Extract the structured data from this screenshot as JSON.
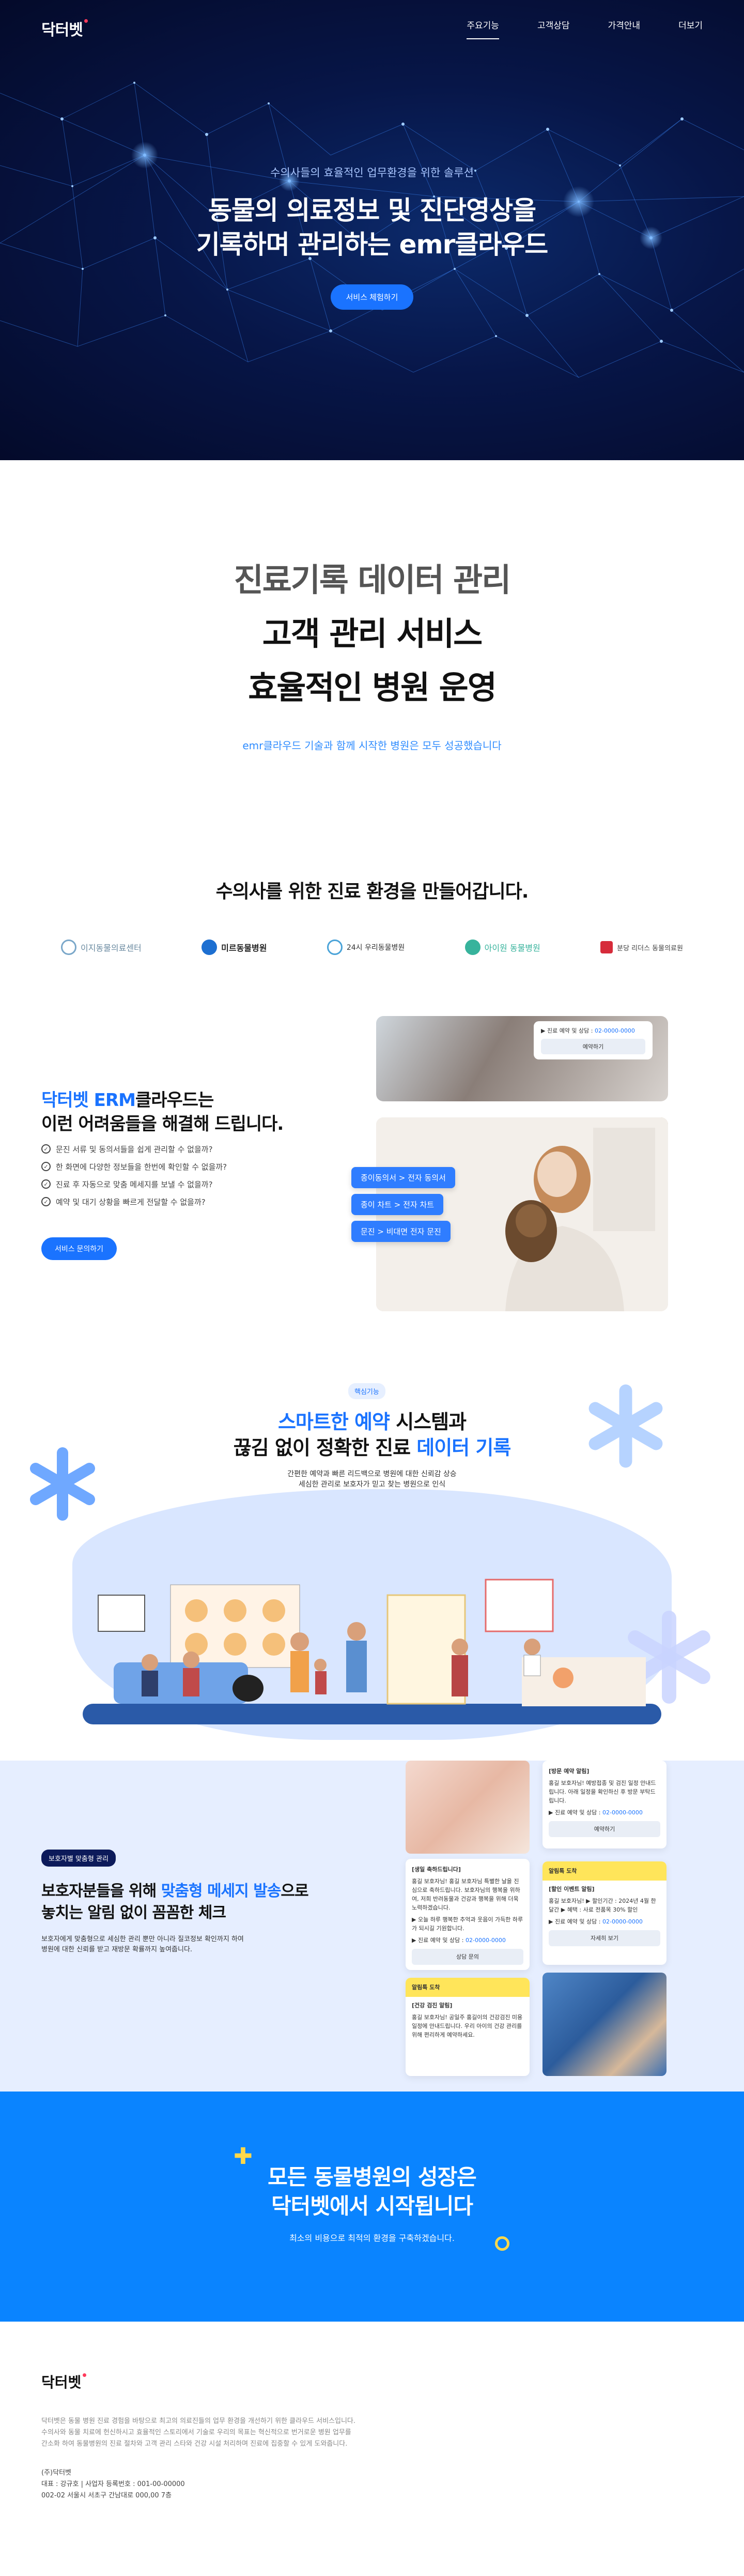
{
  "header": {
    "logo": "닥터벳",
    "nav": [
      "주요기능",
      "고객상담",
      "가격안내",
      "더보기"
    ]
  },
  "hero": {
    "subtitle": "수의사들의 효율적인 업무환경을 위한 솔루션",
    "title_line1": "동물의 의료정보 및 진단영상을",
    "title_line2": "기록하며 관리하는 emr클라우드",
    "button": "서비스 체험하기"
  },
  "intro": {
    "line1": "진료기록 데이터 관리",
    "line2": "고객 관리 서비스",
    "line3": "효율적인 병원 운영",
    "desc": "emr클라우드 기술과 함께 시작한 병원은 모두 성공했습니다"
  },
  "partners": {
    "title": "수의사를 위한 진료 환경을 만들어갑니다.",
    "logos": [
      "이지동물의료센터",
      "미르동물병원",
      "24시 우리동물병원",
      "아이원 동물병원",
      "분당 리더스 동물의료원"
    ]
  },
  "solution": {
    "title_brand": "닥터벳 ERM",
    "title_rest": "클라우드는",
    "title_line2": "이런 어려움들을 해결해 드립니다.",
    "items": [
      "문진 서류 및 동의서들을 쉽게 관리할 수 없을까?",
      "한 화면에 다양한 정보들을 한번에 확인할 수 없을까?",
      "진료 후 자동으로 맞춤 메세지를 보낼 수 없을까?",
      "예약 및 대기 상황을 빠르게 전달할 수 없을까?"
    ],
    "button": "서비스 문의하기",
    "card_label": "▶ 진료 예약 및 상담 : ",
    "card_phone": "02-0000-0000",
    "card_button": "예약하기",
    "chips": [
      "종이동의서 > 전자 동의서",
      "종이 차트 > 전자 차트",
      "문진 > 비대면 전자 문진"
    ]
  },
  "feature": {
    "tag": "핵심기능",
    "t1_blue": "스마트한 예약",
    "t1_rest": " 시스템과",
    "t2_a": "끊김 없이 정확한 진료 ",
    "t2_blue": "데이터 기록",
    "desc1": "간편한 예약과 빠른 리드백으로 병원에 대한 신뢰감 상승",
    "desc2": "세심한 관리로 보호자가 믿고 찾는 병원으로 인식"
  },
  "notice": {
    "tag": "보호자별 맞춤형 관리",
    "t1_a": "보호자분들을 위해 ",
    "t1_blue": "맞춤형 메세지 발송",
    "t1_b": "으로",
    "t2": "놓치는 알림 없이 꼼꼼한 체크",
    "desc1": "보호자에게 맞춤형으로 세심한 관리 뿐만 아니라 질코정보 확인까지 하여",
    "desc2": "병원에 대한 신뢰를 받고 재방문 확률까지 높여줍니다.",
    "card_visit_title": "[방문 예약 알림]",
    "card_visit_body": "홍길 보호자님! 예방접종 및 검진 일정 안내드립니다. 아래 일정을 확인하신 후 방문 부탁드립니다.",
    "card_contact_label": "▶ 진료 예약 및 상담 : ",
    "card_phone": "02-0000-0000",
    "card_visit_btn": "예약하기",
    "card_alert_hd": "알림톡 도착",
    "card_event_title": "[할인 이벤트 알림]",
    "card_event_body": "홍길 보호자님! ▶ 할인기간 : 2024년 4월 한 달간 ▶ 혜택 : 사료 전품목 30% 할인",
    "card_event_btn": "자세히 보기",
    "card_birthday_title": "[생일 축하드립니다]",
    "card_birthday_body": "홍길 보호자님! 홍길 보호자님 특별한 날을 진심으로 축하드립니다. 보호자님의 행복을 위하여, 저희 반려동물과 건강과 행복을 위해 더욱 노력하겠습니다.",
    "card_birthday_note": "▶ 오늘 하루 행복한 추억과 웃음이 가득한 하루가 되시길 기원합니다.",
    "card_birthday_btn": "상담 문의",
    "card_checkup_title": "[건강 검진 알림]",
    "card_checkup_body": "홍길 보호자님! 공일주 홍길이의 건강검진 미용 일정에 안내드립니다. 우리 아이의 건강 관리를 위해 편리하게 예약하세요."
  },
  "cta": {
    "line1": "모든 동물병원의 성장은",
    "line2": "닥터벳에서 시작됩니다",
    "desc": "최소의 비용으로 최적의 환경을 구축하겠습니다."
  },
  "footer": {
    "logo": "닥터벳",
    "desc1": "닥터벳은 동물 병원 진료 경험을 바탕으로 최고의 의료진들의 업무 환경을 개선하기 위한 클라우드 서비스입니다.",
    "desc2": "수의사와 동물 치료에 헌신하시고 효율적인 스토리에서 기술로 우리의 목표는 혁신적으로 번거로운 병원 업무를",
    "desc3": "간소화 하여 동물병원의 진료 절차와 고객 관리 스타와 건강 시설 처리하며 진료에 집중할 수 있게 도와줍니다.",
    "company": "(주)닥터벳",
    "ceo": "대표 : 강규호 | 사업자 등록번호 : 001-00-00000",
    "address": "002-02 서울시 서초구 간남대로 000,00 7층"
  },
  "colors": {
    "brand_blue": "#1a73ff",
    "hero_bg": "#071648",
    "cta_bg": "#0a84ff",
    "accent_yellow": "#ffd84a",
    "logo_dot": "#ff3b5c"
  }
}
